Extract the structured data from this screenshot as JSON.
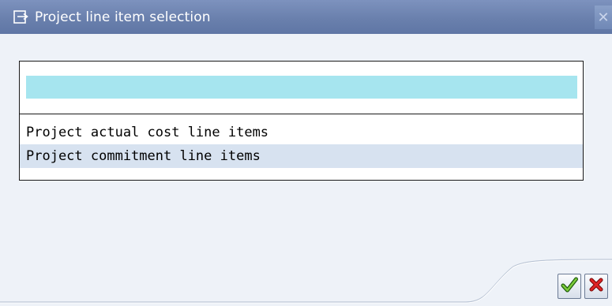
{
  "window": {
    "title": "Project line item selection",
    "title_icon": "window-icon",
    "close_icon": "close-icon",
    "close_glyph": "✕"
  },
  "list": {
    "items": [
      {
        "label": "Project actual cost line items",
        "selected": false
      },
      {
        "label": "Project commitment line items",
        "selected": true
      }
    ],
    "header_color": "#a6e5ef",
    "selected_color": "#d7e2f0"
  },
  "footer": {
    "ok_icon": "checkmark-icon",
    "cancel_icon": "cancel-x-icon",
    "ok_color": "#3a9a1a",
    "cancel_color": "#d01818"
  },
  "colors": {
    "titlebar": "#6a80ad",
    "background": "#eef2f8"
  }
}
